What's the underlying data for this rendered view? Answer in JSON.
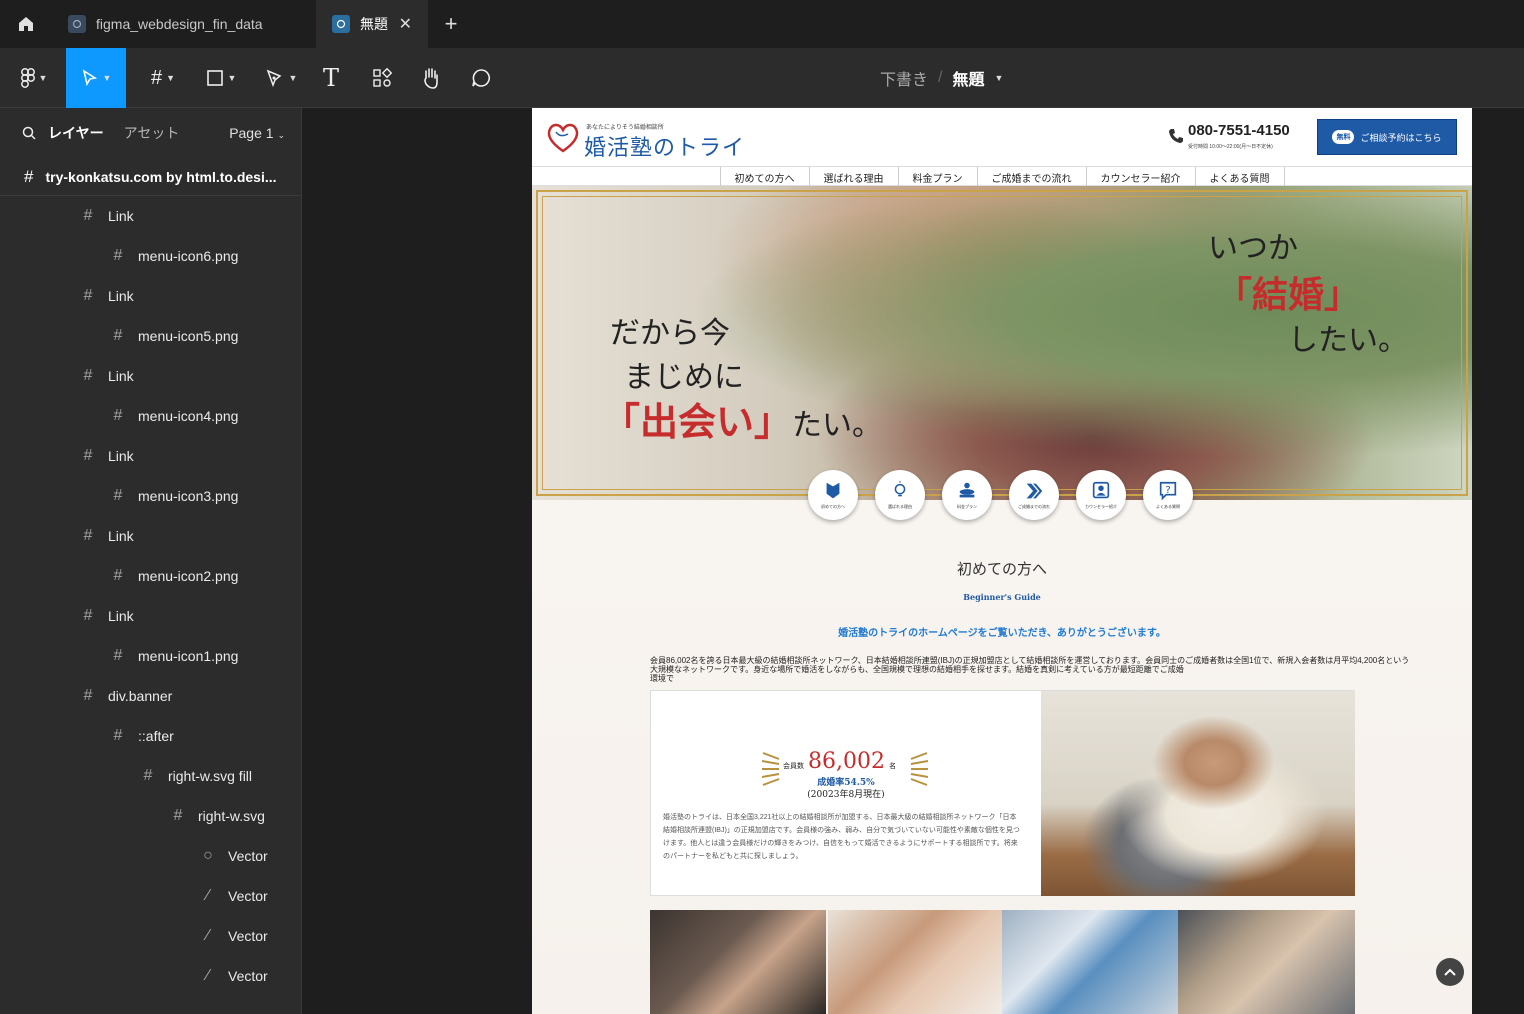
{
  "tabs": {
    "file1": "figma_webdesign_fin_data",
    "file2": "無題"
  },
  "toolbar": {
    "draft": "下書き",
    "slash": "/",
    "file_name": "無題"
  },
  "layers_panel": {
    "tab_layers": "レイヤー",
    "tab_assets": "アセット",
    "page": "Page 1",
    "frame": "try-konkatsu.com by html.to.desi...",
    "items": [
      {
        "label": "Link",
        "icon": "frame-icon"
      },
      {
        "label": "menu-icon6.png",
        "icon": "frame-icon"
      },
      {
        "label": "Link",
        "icon": "frame-icon"
      },
      {
        "label": "menu-icon5.png",
        "icon": "frame-icon"
      },
      {
        "label": "Link",
        "icon": "frame-icon"
      },
      {
        "label": "menu-icon4.png",
        "icon": "frame-icon"
      },
      {
        "label": "Link",
        "icon": "frame-icon"
      },
      {
        "label": "menu-icon3.png",
        "icon": "frame-icon"
      },
      {
        "label": "Link",
        "icon": "frame-icon"
      },
      {
        "label": "menu-icon2.png",
        "icon": "frame-icon"
      },
      {
        "label": "Link",
        "icon": "frame-icon"
      },
      {
        "label": "menu-icon1.png",
        "icon": "frame-icon"
      },
      {
        "label": "div.banner",
        "icon": "frame-icon"
      },
      {
        "label": "::after",
        "icon": "frame-icon"
      },
      {
        "label": "right-w.svg fill",
        "icon": "frame-icon"
      },
      {
        "label": "right-w.svg",
        "icon": "frame-icon"
      },
      {
        "label": "Vector",
        "icon": "ellipse-icon"
      },
      {
        "label": "Vector",
        "icon": "vector-icon"
      },
      {
        "label": "Vector",
        "icon": "vector-icon"
      },
      {
        "label": "Vector",
        "icon": "vector-icon"
      }
    ]
  },
  "site": {
    "tagline": "あなたによりそう結婚相談所",
    "logo": "婚活塾のトライ",
    "phone": "080-7551-4150",
    "phone_hours": "受付時間 10:00〜22:00(月〜日不定休)",
    "cta_badge": "無料",
    "cta": "ご相談予約はこちら",
    "nav": [
      "初めての方へ",
      "選ばれる理由",
      "料金プラン",
      "ご成婚までの流れ",
      "カウンセラー紹介",
      "よくある質問"
    ],
    "hero_left": [
      "だから今",
      "まじめに",
      "「出会い」",
      "たい。"
    ],
    "hero_right": [
      "いつか",
      "「結婚」",
      "したい。"
    ],
    "circle_icons": [
      "初めての方へ",
      "選ばれる理由",
      "料金プラン",
      "ご成婚までの流れ",
      "カウンセラー紹介",
      "よくある質問"
    ],
    "section_title": "初めての方へ",
    "section_sub": "Beginner's Guide",
    "section_lead": "婚活塾のトライのホームページをご覧いただき、ありがとうございます。",
    "section_body_1": "会員86,002名を誇る日本最大級の結婚相談所ネットワーク、日本結婚相談所連盟(IBJ)の正規加盟店として結婚相談所を運営しております。会員同士のご成婚者数は全国1位で、新規入会者数は月平均4,200名という大規模なネットワークです。身近な場所で婚活をしながらも、全国規模で理想の結婚相手を探せます。結婚を真剣に考えている方が最短距離でご成婚",
    "section_body_2": "環境で",
    "card_label": "会員数",
    "card_number": "86,002",
    "card_unit": "名",
    "card_rate": "成婚率54.5%",
    "card_date": "(20023年8月現在)",
    "card_text": "婚活塾のトライは、日本全国3,221社以上の結婚相談所が加盟する、日本最大級の結婚相談所ネットワーク「日本結婚相談所連盟(IBJ)」の正規加盟店です。会員様の強み、弱み、自分で気づいていない可能性や素敵な個性を見つけます。他人とは違う会員様だけの輝きをみつけ、自信をもって婚活できるようにサポートする相談所です。将来のパートナーを私どもと共に探しましょう。"
  }
}
